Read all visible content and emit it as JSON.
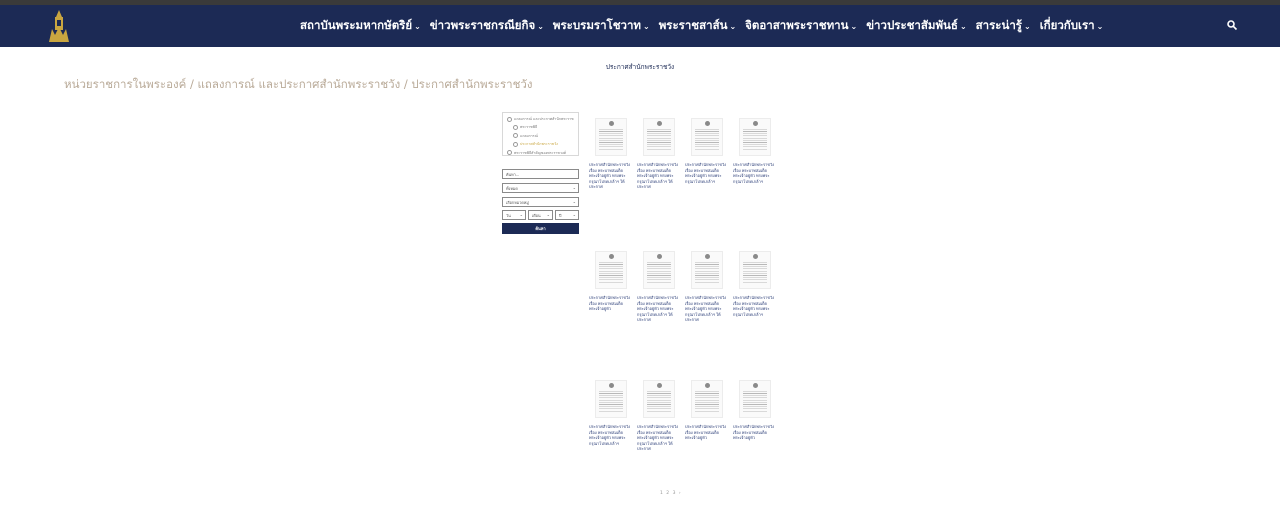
{
  "nav": {
    "items": [
      {
        "label": "สถาบันพระมหากษัตริย์"
      },
      {
        "label": "ข่าวพระราชกรณียกิจ"
      },
      {
        "label": "พระบรมราโชวาท"
      },
      {
        "label": "พระราชสาส์น"
      },
      {
        "label": "จิตอาสาพระราชทาน"
      },
      {
        "label": "ข่าวประชาสัมพันธ์"
      },
      {
        "label": "สาระน่ารู้"
      },
      {
        "label": "เกี่ยวกับเรา"
      }
    ]
  },
  "page": {
    "heading": "ประกาศสำนักพระราชวัง",
    "breadcrumb": "หน่วยราชการในพระองค์ / แถลงการณ์ และประกาศสำนักพระราชวัง / ประกาศสำนักพระราชวัง"
  },
  "sidebar": {
    "categories": [
      {
        "label": "แถลงการณ์ และประกาศสำนักพระราชวัง",
        "active": false,
        "sub": false
      },
      {
        "label": "พระราชพิธี",
        "active": false,
        "sub": true
      },
      {
        "label": "แถลงการณ์",
        "active": false,
        "sub": true
      },
      {
        "label": "ประกาศสำนักพระราชวัง",
        "active": true,
        "sub": true
      },
      {
        "label": "พระราชพิธีสำคัญของพระราชวงศ์",
        "active": false,
        "sub": false
      }
    ],
    "search_placeholder": "ค้นหา...",
    "select_1": "ทั้งหมด",
    "select_2": "เลือกหมวดหมู่",
    "day": "วัน",
    "month": "เดือน",
    "year": "ปี",
    "submit": "ค้นหา"
  },
  "cards": [
    {
      "caption": "ประกาศสำนักพระราชวัง เรื่อง พระบาทสมเด็จพระเจ้าอยู่หัว ทรงพระกรุณาโปรดเกล้าฯ ให้ประกาศ"
    },
    {
      "caption": "ประกาศสำนักพระราชวัง เรื่อง พระบาทสมเด็จพระเจ้าอยู่หัว ทรงพระกรุณาโปรดเกล้าฯ ให้ประกาศ"
    },
    {
      "caption": "ประกาศสำนักพระราชวัง เรื่อง พระบาทสมเด็จพระเจ้าอยู่หัว ทรงพระกรุณาโปรดเกล้าฯ"
    },
    {
      "caption": "ประกาศสำนักพระราชวัง เรื่อง พระบาทสมเด็จพระเจ้าอยู่หัว ทรงพระกรุณาโปรดเกล้าฯ"
    },
    {
      "caption": "ประกาศสำนักพระราชวัง เรื่อง พระบาทสมเด็จพระเจ้าอยู่หัว"
    },
    {
      "caption": "ประกาศสำนักพระราชวัง เรื่อง พระบาทสมเด็จพระเจ้าอยู่หัว ทรงพระกรุณาโปรดเกล้าฯ ให้ประกาศ"
    },
    {
      "caption": "ประกาศสำนักพระราชวัง เรื่อง พระบาทสมเด็จพระเจ้าอยู่หัว ทรงพระกรุณาโปรดเกล้าฯ ให้ประกาศ"
    },
    {
      "caption": "ประกาศสำนักพระราชวัง เรื่อง พระบาทสมเด็จพระเจ้าอยู่หัว ทรงพระกรุณาโปรดเกล้าฯ"
    },
    {
      "caption": "ประกาศสำนักพระราชวัง เรื่อง พระบาทสมเด็จพระเจ้าอยู่หัว ทรงพระกรุณาโปรดเกล้าฯ"
    },
    {
      "caption": "ประกาศสำนักพระราชวัง เรื่อง พระบาทสมเด็จพระเจ้าอยู่หัว ทรงพระกรุณาโปรดเกล้าฯ ให้ประกาศ"
    },
    {
      "caption": "ประกาศสำนักพระราชวัง เรื่อง พระบาทสมเด็จพระเจ้าอยู่หัว"
    },
    {
      "caption": "ประกาศสำนักพระราชวัง เรื่อง พระบาทสมเด็จพระเจ้าอยู่หัว"
    }
  ],
  "pagination": "1 2 3 ›"
}
